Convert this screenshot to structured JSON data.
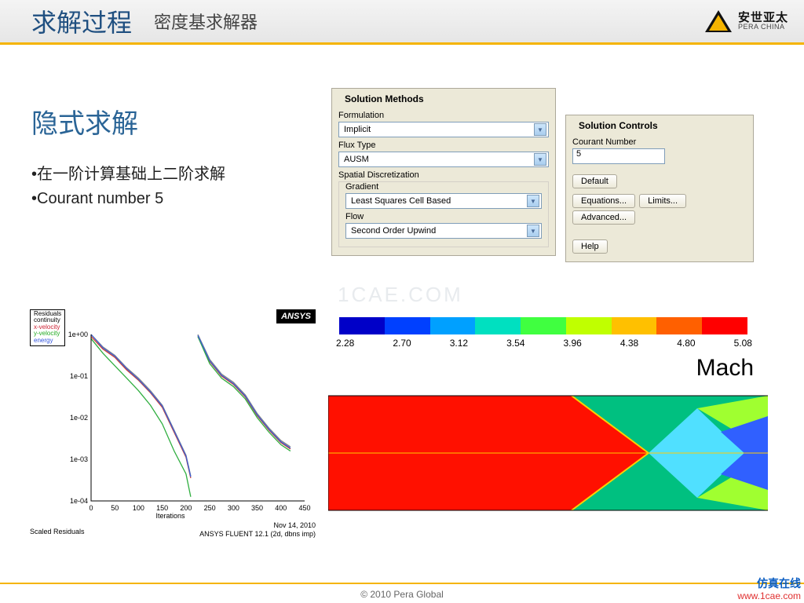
{
  "header": {
    "title_main": "求解过程",
    "title_sub": "密度基求解器",
    "brand_cn": "安世亚太",
    "brand_en": "PERA CHINA"
  },
  "left": {
    "heading": "隐式求解",
    "bullets": [
      "•在一阶计算基础上二阶求解",
      "•Courant number 5"
    ]
  },
  "methods": {
    "panel_title": "Solution Methods",
    "formulation_label": "Formulation",
    "formulation_value": "Implicit",
    "flux_label": "Flux Type",
    "flux_value": "AUSM",
    "spatial_label": "Spatial Discretization",
    "gradient_label": "Gradient",
    "gradient_value": "Least Squares Cell Based",
    "flow_label": "Flow",
    "flow_value": "Second Order Upwind"
  },
  "controls": {
    "panel_title": "Solution Controls",
    "courant_label": "Courant Number",
    "courant_value": "5",
    "buttons": {
      "default": "Default",
      "equations": "Equations...",
      "limits": "Limits...",
      "advanced": "Advanced...",
      "help": "Help"
    }
  },
  "watermark": "1CAE.COM",
  "residuals": {
    "legend": [
      "Residuals",
      "continuity",
      "x-velocity",
      "y-velocity",
      "energy"
    ],
    "badge": "ANSYS",
    "xlabel": "Iterations",
    "footer_left": "Scaled Residuals",
    "footer_right_1": "Nov 14, 2010",
    "footer_right_2": "ANSYS FLUENT 12.1 (2d, dbns imp)",
    "yticks": [
      "1e+00",
      "1e-01",
      "1e-02",
      "1e-03",
      "1e-04"
    ],
    "xticks": [
      "0",
      "50",
      "100",
      "150",
      "200",
      "250",
      "300",
      "350",
      "400",
      "450"
    ]
  },
  "chart_data": {
    "type": "line",
    "title": "Scaled Residuals",
    "xlabel": "Iterations",
    "ylabel": "Residual",
    "xlim": [
      0,
      450
    ],
    "ylim_log10": [
      -4,
      0
    ],
    "x": [
      0,
      25,
      50,
      75,
      100,
      125,
      150,
      175,
      200,
      210,
      225,
      250,
      275,
      300,
      325,
      350,
      375,
      400,
      420
    ],
    "series": [
      {
        "name": "continuity",
        "color": "#ffffff_outline",
        "values_log10": [
          0.0,
          -0.3,
          -0.5,
          -0.8,
          -1.05,
          -1.35,
          -1.7,
          -2.3,
          -2.9,
          -3.4,
          0.0,
          -0.6,
          -0.95,
          -1.15,
          -1.45,
          -1.9,
          -2.25,
          -2.55,
          -2.7
        ]
      },
      {
        "name": "x-velocity",
        "color": "#d04030",
        "values_log10": [
          -0.05,
          -0.35,
          -0.55,
          -0.85,
          -1.1,
          -1.4,
          -1.75,
          -2.35,
          -2.95,
          -3.45,
          -0.05,
          -0.65,
          -1.0,
          -1.2,
          -1.5,
          -1.95,
          -2.3,
          -2.6,
          -2.75
        ]
      },
      {
        "name": "y-velocity",
        "color": "#2fae3f",
        "values_log10": [
          -0.1,
          -0.45,
          -0.75,
          -1.05,
          -1.35,
          -1.7,
          -2.15,
          -2.8,
          -3.35,
          -3.9,
          -0.05,
          -0.7,
          -1.05,
          -1.25,
          -1.55,
          -2.0,
          -2.35,
          -2.65,
          -2.8
        ]
      },
      {
        "name": "energy",
        "color": "#3b5fd6",
        "values_log10": [
          0.0,
          -0.32,
          -0.52,
          -0.82,
          -1.08,
          -1.38,
          -1.72,
          -2.32,
          -2.92,
          -3.42,
          -0.02,
          -0.63,
          -0.98,
          -1.18,
          -1.48,
          -1.93,
          -2.28,
          -2.58,
          -2.73
        ]
      }
    ]
  },
  "mach": {
    "label": "Mach",
    "colorbar_values": [
      "2.28",
      "2.70",
      "3.12",
      "3.54",
      "3.96",
      "4.38",
      "4.80",
      "5.08"
    ],
    "colorbar_colors": [
      "#0000c8",
      "#0040ff",
      "#00a0ff",
      "#00e0c0",
      "#40ff40",
      "#c0ff00",
      "#ffc000",
      "#ff6000",
      "#ff0000"
    ]
  },
  "footer": {
    "copyright": "© 2010 Pera Global",
    "src_cn": "仿真在线",
    "src_url": "www.1cae.com"
  }
}
